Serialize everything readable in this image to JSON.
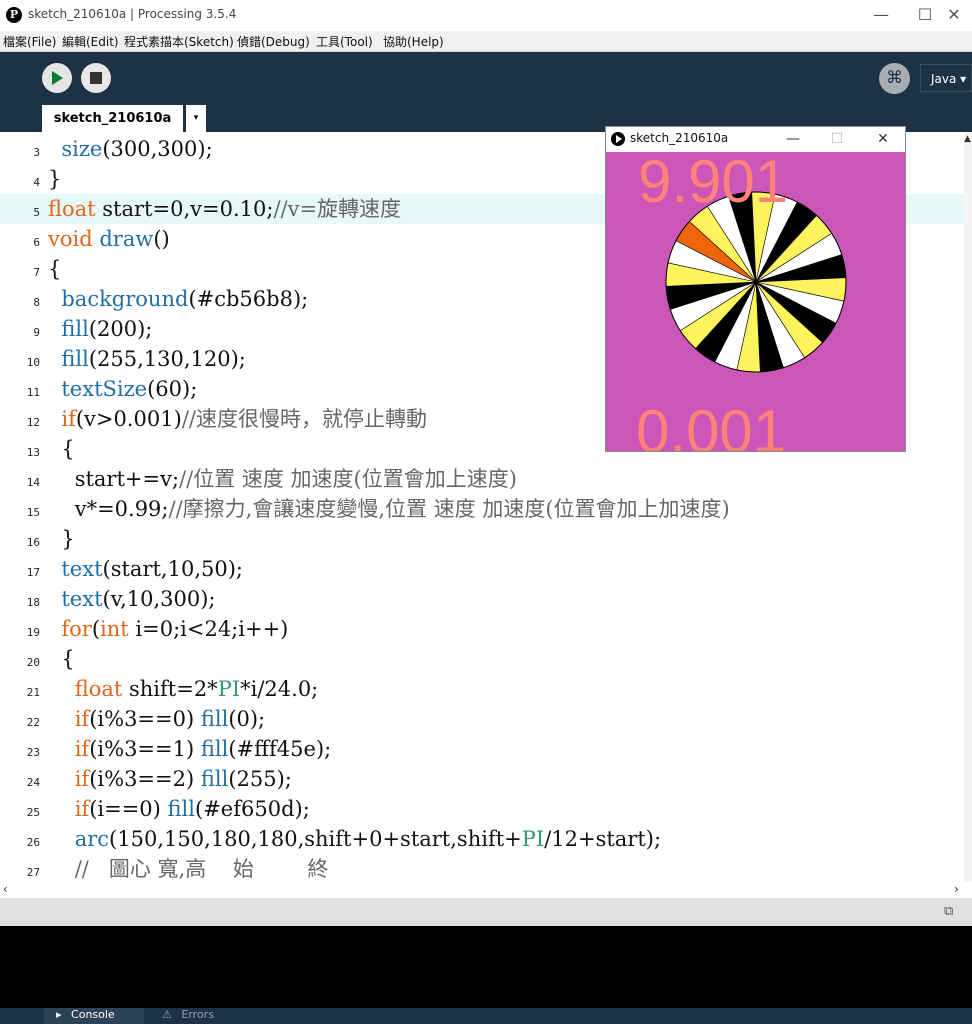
{
  "window": {
    "title": "sketch_210610a | Processing 3.5.4",
    "minimize": "—",
    "maximize": "☐",
    "close": "✕"
  },
  "menu": [
    "檔案(File)",
    "編輯(Edit)",
    "程式素描本(Sketch)",
    "偵錯(Debug)",
    "工具(Tool)",
    "協助(Help)"
  ],
  "toolbar": {
    "debug_icon": "debug-butterfly-icon",
    "mode": "Java ▾"
  },
  "tab": {
    "name": "sketch_210610a",
    "menu": "▾"
  },
  "editor": {
    "current_line": 5,
    "lines": [
      {
        "n": "3",
        "t": "  size(300,300);"
      },
      {
        "n": "4",
        "t": "}"
      },
      {
        "n": "5",
        "t": "float start=0,v=0.10;//v=旋轉速度"
      },
      {
        "n": "6",
        "t": "void draw()"
      },
      {
        "n": "7",
        "t": "{"
      },
      {
        "n": "8",
        "t": "  background(#cb56b8);"
      },
      {
        "n": "9",
        "t": "  fill(200);"
      },
      {
        "n": "10",
        "t": "  fill(255,130,120);"
      },
      {
        "n": "11",
        "t": "  textSize(60);"
      },
      {
        "n": "12",
        "t": "  if(v>0.001)//速度很慢時，就停止轉動"
      },
      {
        "n": "13",
        "t": "  {"
      },
      {
        "n": "14",
        "t": "    start+=v;//位置 速度 加速度(位置會加上速度)"
      },
      {
        "n": "15",
        "t": "    v*=0.99;//摩擦力,會讓速度變慢,位置 速度 加速度(位置會加上加速度)"
      },
      {
        "n": "16",
        "t": "  }"
      },
      {
        "n": "17",
        "t": "  text(start,10,50);"
      },
      {
        "n": "18",
        "t": "  text(v,10,300);"
      },
      {
        "n": "19",
        "t": "  for(int i=0;i<24;i++)"
      },
      {
        "n": "20",
        "t": "  {"
      },
      {
        "n": "21",
        "t": "    float shift=2*PI*i/24.0;"
      },
      {
        "n": "22",
        "t": "    if(i%3==0) fill(0);"
      },
      {
        "n": "23",
        "t": "    if(i%3==1) fill(#fff45e);"
      },
      {
        "n": "24",
        "t": "    if(i%3==2) fill(255);"
      },
      {
        "n": "25",
        "t": "    if(i==0) fill(#ef650d);"
      },
      {
        "n": "26",
        "t": "    arc(150,150,180,180,shift+0+start,shift+PI/12+start);"
      },
      {
        "n": "27",
        "t": "    //   圖心 寬,高    始        終"
      }
    ]
  },
  "console_tabs": {
    "console": "Console",
    "errors": "Errors"
  },
  "sketch_window": {
    "title": "sketch_210610a",
    "background": "#cb56b8",
    "text_color": "#ff8278",
    "start_value": "9.901",
    "v_value": "0.001",
    "wheel": {
      "segments": 24,
      "start_angle_rad": 9.901,
      "colors": [
        "#000000",
        "#fff45e",
        "#ffffff"
      ],
      "first_color": "#ef650d"
    }
  },
  "colors": {
    "toolbar_bg": "#1e3246",
    "keyword_orange": "#e2661a",
    "function_blue": "#1f6fa6",
    "constant_green": "#33997e",
    "comment": "#666666"
  }
}
